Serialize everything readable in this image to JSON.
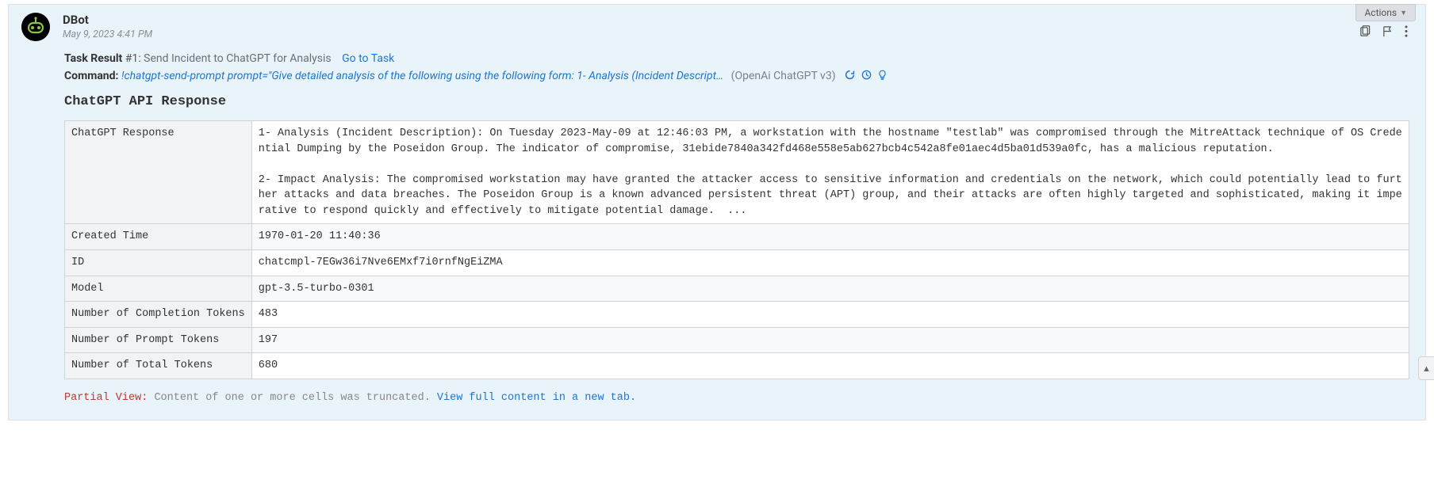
{
  "actions": {
    "label": "Actions"
  },
  "author": "DBot",
  "timestamp": "May 9, 2023 4:41 PM",
  "task": {
    "label": "Task Result",
    "number": "#1:",
    "description": "Send Incident to ChatGPT for Analysis",
    "go_to_task": "Go to Task"
  },
  "command": {
    "label": "Command:",
    "text": "!chatgpt-send-prompt prompt=\"Give detailed analysis of the following using the following form: 1- Analysis (Incident Descript…",
    "integration": "(OpenAi ChatGPT v3)"
  },
  "response_title": "ChatGPT API Response",
  "table": [
    {
      "label": "ChatGPT Response",
      "value": "1- Analysis (Incident Description): On Tuesday 2023-May-09 at 12:46:03 PM, a workstation with the hostname \"testlab\" was compromised through the MitreAttack technique of OS Credential Dumping by the Poseidon Group. The indicator of compromise, 31ebide7840a342fd468e558e5ab627bcb4c542a8fe01aec4d5ba01d539a0fc, has a malicious reputation.\n\n2- Impact Analysis: The compromised workstation may have granted the attacker access to sensitive information and credentials on the network, which could potentially lead to further attacks and data breaches. The Poseidon Group is a known advanced persistent threat (APT) group, and their attacks are often highly targeted and sophisticated, making it imperative to respond quickly and effectively to mitigate potential damage.  ..."
    },
    {
      "label": "Created Time",
      "value": "1970-01-20 11:40:36"
    },
    {
      "label": "ID",
      "value": "chatcmpl-7EGw36i7Nve6EMxf7i0rnfNgEiZMA"
    },
    {
      "label": "Model",
      "value": "gpt-3.5-turbo-0301"
    },
    {
      "label": "Number of Completion Tokens",
      "value": "483"
    },
    {
      "label": "Number of Prompt Tokens",
      "value": "197"
    },
    {
      "label": "Number of Total Tokens",
      "value": "680"
    }
  ],
  "partial": {
    "label": "Partial View:",
    "text": "Content of one or more cells was truncated.",
    "link": "View full content in a new tab."
  }
}
